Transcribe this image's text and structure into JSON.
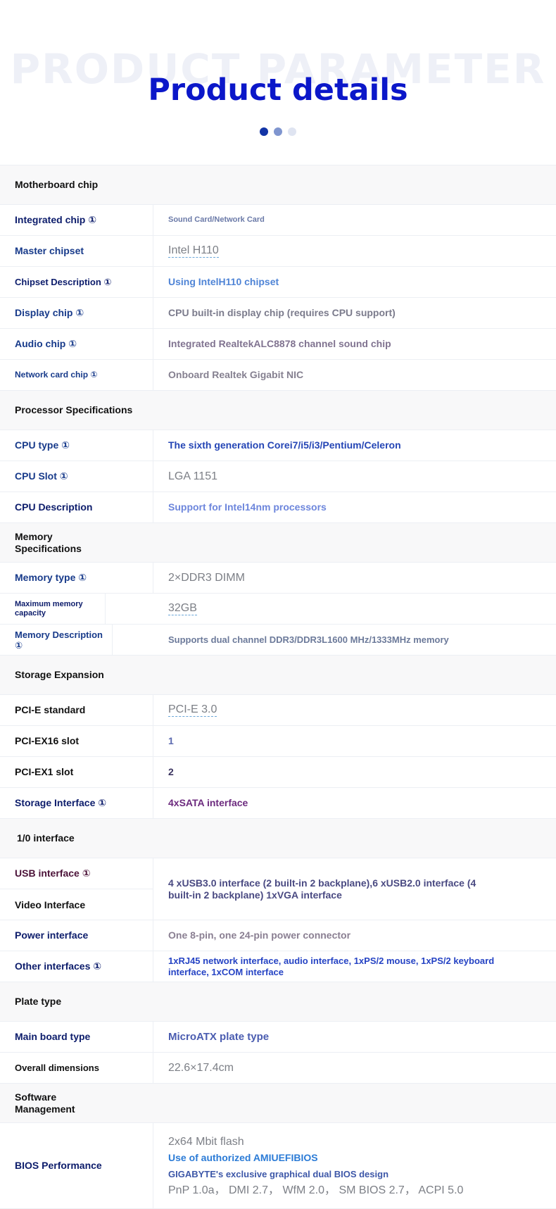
{
  "header": {
    "watermark": "PRODUCT PARAMETER",
    "title": "Product details",
    "dots": [
      "#1234a6",
      "#7f95cf",
      "#dfe4f1"
    ]
  },
  "sections": {
    "motherboard": {
      "title": "Motherboard chip",
      "integrated_label": "Integrated chip ①",
      "integrated_value": "Sound Card/Network Card",
      "master_label": "Master chipset",
      "master_value": "Intel H110",
      "chipset_desc_label": "Chipset Description ①",
      "chipset_desc_value": "Using IntelH110 chipset",
      "display_label": "Display chip ①",
      "display_value": "CPU built-in display chip (requires CPU support)",
      "audio_label": "Audio chip ①",
      "audio_value": "Integrated RealtekALC8878 channel sound chip",
      "network_label": "Network card chip ①",
      "network_value": "Onboard Realtek Gigabit NIC"
    },
    "processor": {
      "title": "Processor Specifications",
      "cpu_type_label": "CPU type ①",
      "cpu_type_value": "The sixth generation Corei7/i5/i3/Pentium/Celeron",
      "cpu_slot_label": "CPU Slot ①",
      "cpu_slot_value": "LGA 1151",
      "cpu_desc_label": "CPU Description",
      "cpu_desc_value": "Support for Intel14nm processors"
    },
    "memory": {
      "title": "Memory Specifications",
      "type_label": "Memory type ①",
      "type_value": "2×DDR3 DIMM",
      "max_label": "Maximum memory capacity",
      "max_value": "32GB",
      "desc_label": "Memory Description ①",
      "desc_value": "Supports dual channel DDR3/DDR3L1600 MHz/1333MHz memory"
    },
    "storage": {
      "title": "Storage Expansion",
      "pcie_label": "PCI-E standard",
      "pcie_value": "PCI-E 3.0",
      "x16_label": "PCI-EX16 slot",
      "x16_value": "1",
      "x1_label": "PCI-EX1 slot",
      "x1_value": "2",
      "interface_label": "Storage Interface ①",
      "interface_value": "4xSATA interface"
    },
    "io": {
      "title": "1/0 interface",
      "usb_label": "USB interface ①",
      "video_label": "Video Interface",
      "usb_video_value": "4 xUSB3.0 interface (2 built-in 2 backplane),6 xUSB2.0 interface (4 built-in 2 backplane) 1xVGA interface",
      "power_label": "Power interface",
      "power_value": "One 8-pin, one 24-pin power connector",
      "other_label": "Other interfaces ①",
      "other_value": "1xRJ45 network interface, audio interface, 1xPS/2 mouse, 1xPS/2 keyboard interface, 1xCOM interface"
    },
    "plate": {
      "title": "Plate type",
      "board_label": "Main board type",
      "board_value": "MicroATX plate type",
      "dims_label": "Overall dimensions",
      "dims_value": "22.6×17.4cm"
    },
    "software": {
      "title": "Software Management",
      "bios_label": "BIOS Performance",
      "bios_lines": [
        "2x64 Mbit flash",
        "Use of authorized AMIUEFIBIOS",
        "GIGABYTE's exclusive graphical dual BIOS design",
        "PnP 1.0a， DMI 2.7， WfM 2.0， SM BIOS 2.7， ACPI 5.0"
      ]
    }
  }
}
